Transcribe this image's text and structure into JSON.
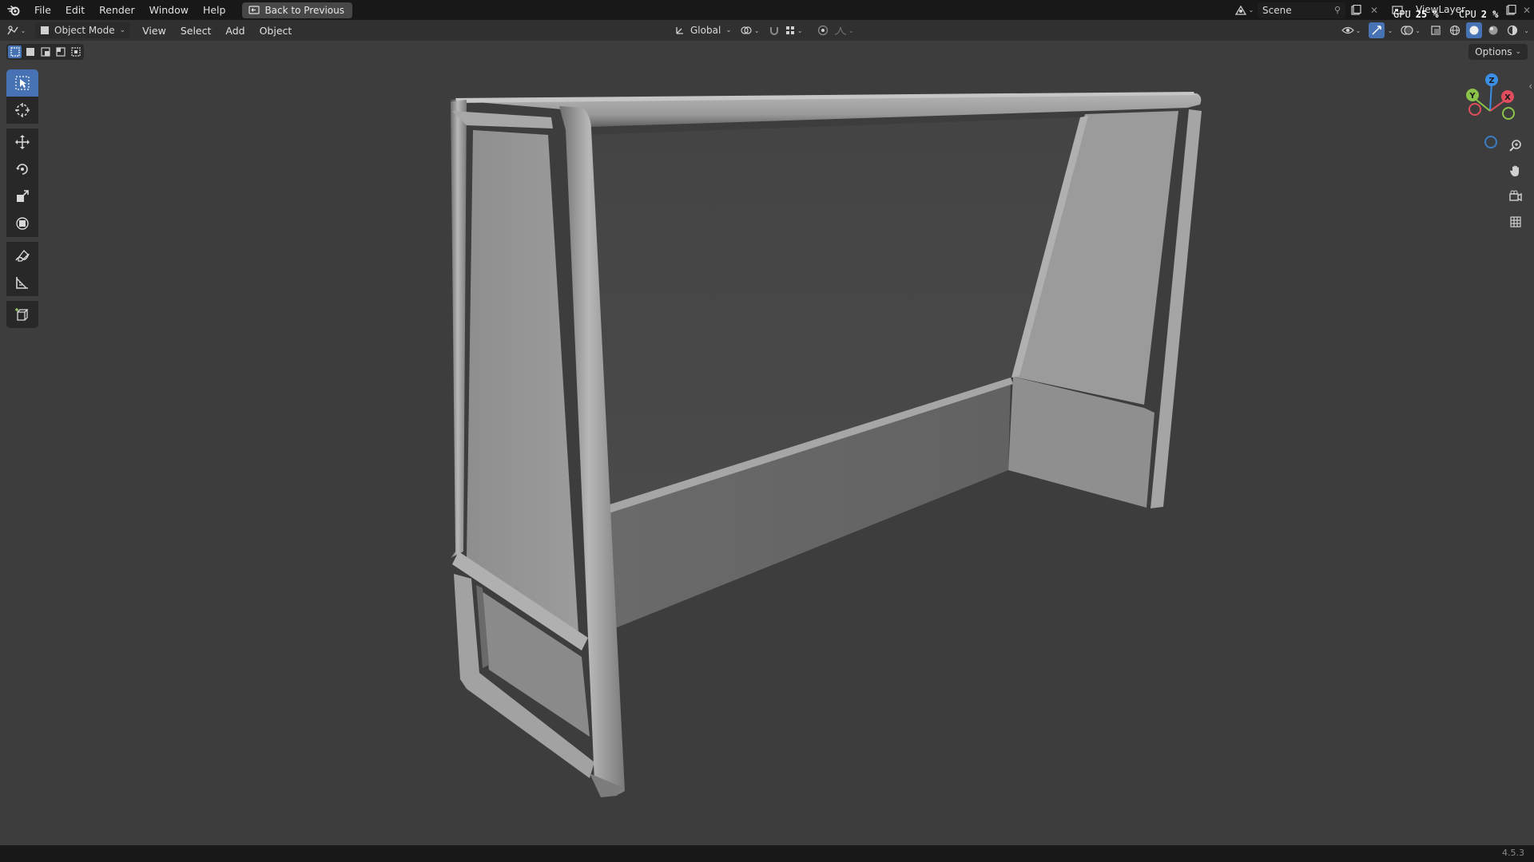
{
  "topbar": {
    "menus": [
      "File",
      "Edit",
      "Render",
      "Window",
      "Help"
    ],
    "back_button": "Back to Previous",
    "scene_name": "Scene",
    "view_layer": "ViewLayer",
    "gpu_label": "GPU",
    "gpu_value": "25 %",
    "cpu_label": "CPU",
    "cpu_value": "2 %"
  },
  "header": {
    "mode": "Object Mode",
    "menus": [
      "View",
      "Select",
      "Add",
      "Object"
    ],
    "orientation": "Global"
  },
  "viewport": {
    "options_label": "Options",
    "gizmo": {
      "x": "X",
      "y": "Y",
      "z": "Z"
    }
  },
  "toolbar": {
    "tools": [
      "select-box",
      "cursor",
      "move",
      "rotate",
      "scale",
      "transform",
      "annotate",
      "measure",
      "add-cube"
    ],
    "active": "select-box"
  },
  "statusbar": {
    "version": "4.5.3"
  },
  "colors": {
    "accent": "#4772b3",
    "axis_x": "#e04e5d",
    "axis_y": "#8bc34a",
    "axis_z": "#3a8ee6"
  }
}
